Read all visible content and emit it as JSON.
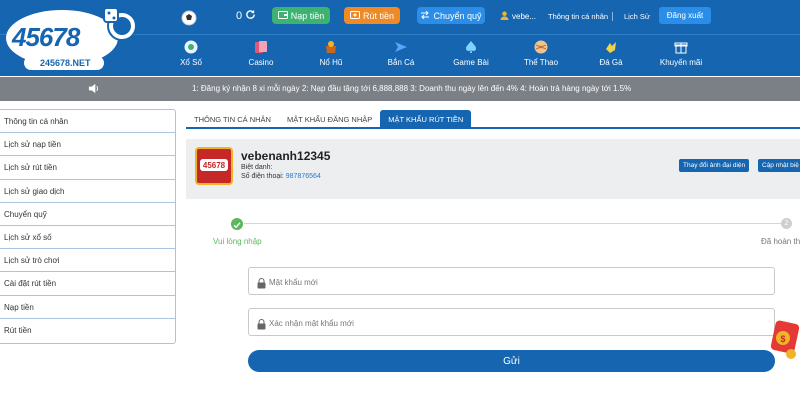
{
  "brand": {
    "logo_text": "45678",
    "logo_domain": "245678.NET"
  },
  "header": {
    "balance": "0",
    "deposit_label": "Nạp tiền",
    "withdraw_label": "Rút tiền",
    "transfer_label": "Chuyển quỹ",
    "username_short": "vebe...",
    "personal_info_link": "Thông tin cá nhân",
    "history_link": "Lịch Sử",
    "logout_label": "Đăng xuất",
    "colors": {
      "deposit": "#3cb371",
      "withdraw": "#f08a24",
      "transfer": "#2a8ee8",
      "header_bg": "#1565b0"
    }
  },
  "nav": {
    "items": [
      {
        "label": "Xổ Số",
        "icon": "lottery-ball-icon"
      },
      {
        "label": "Casino",
        "icon": "cards-icon"
      },
      {
        "label": "Nổ Hũ",
        "icon": "jackpot-icon"
      },
      {
        "label": "Bắn Cá",
        "icon": "fish-icon"
      },
      {
        "label": "Game Bài",
        "icon": "spade-icon"
      },
      {
        "label": "Thể Thao",
        "icon": "ball-icon"
      },
      {
        "label": "Đá Gà",
        "icon": "rooster-icon"
      },
      {
        "label": "Khuyến mãi",
        "icon": "gift-icon"
      }
    ]
  },
  "announcement": {
    "text": "1: Đăng ký nhận 8 xi mỗi ngày 2: Nạp đầu tặng tới 6,888,888 3: Doanh thu ngày lên đến 4% 4: Hoàn trả hàng ngày tới 1.5%"
  },
  "sidebar": {
    "items": [
      {
        "label": "Thông tin cá nhân"
      },
      {
        "label": "Lịch sử nạp tiền"
      },
      {
        "label": "Lịch sử rút tiền"
      },
      {
        "label": "Lịch sử giao dịch"
      },
      {
        "label": "Chuyển quỹ"
      },
      {
        "label": "Lịch sử xổ số"
      },
      {
        "label": "Lịch sử trò chơi"
      },
      {
        "label": "Cài đặt rút tiền"
      },
      {
        "label": "Nạp tiền"
      },
      {
        "label": "Rút tiền"
      }
    ]
  },
  "tabs": [
    {
      "label": "THÔNG TIN CÁ NHÂN",
      "active": false
    },
    {
      "label": "MẬT KHẨU ĐĂNG NHẬP",
      "active": false
    },
    {
      "label": "MẬT KHẨU RÚT TIỀN",
      "active": true
    }
  ],
  "profile": {
    "username": "vebenanh12345",
    "nickname_label": "Biệt danh:",
    "phone_label": "Số điện thoại:",
    "phone_value": "987876564",
    "change_avatar_label": "Thay đổi ảnh đại diện",
    "update_label": "Cập nhật biệ"
  },
  "steps": [
    {
      "label": "Vui lòng nhập",
      "state": "done"
    },
    {
      "label": "Đã hoàn thà",
      "state": "pending",
      "number": "2"
    }
  ],
  "form": {
    "new_password_placeholder": "Mật khẩu mới",
    "confirm_password_placeholder": "Xác nhận mật khẩu mới",
    "new_password_value": "",
    "confirm_password_value": "",
    "submit_label": "Gửi"
  }
}
